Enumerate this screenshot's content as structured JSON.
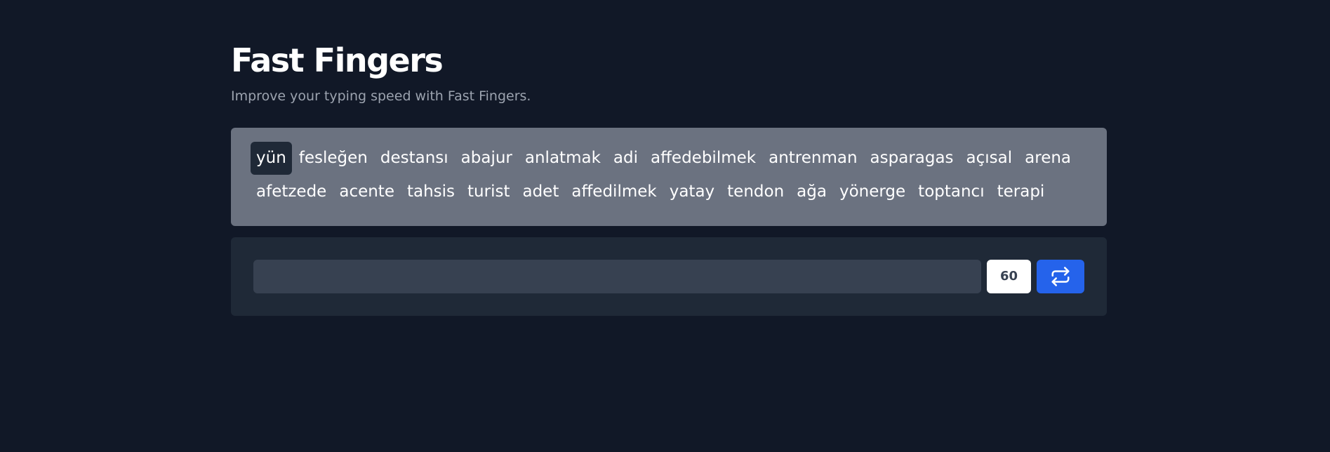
{
  "header": {
    "title": "Fast Fingers",
    "subtitle": "Improve your typing speed with Fast Fingers."
  },
  "words": [
    {
      "text": "yün",
      "current": true
    },
    {
      "text": "fesleğen",
      "current": false
    },
    {
      "text": "destansı",
      "current": false
    },
    {
      "text": "abajur",
      "current": false
    },
    {
      "text": "anlatmak",
      "current": false
    },
    {
      "text": "adi",
      "current": false
    },
    {
      "text": "affedebilmek",
      "current": false
    },
    {
      "text": "antrenman",
      "current": false
    },
    {
      "text": "asparagas",
      "current": false
    },
    {
      "text": "açısal",
      "current": false
    },
    {
      "text": "arena",
      "current": false
    },
    {
      "text": "afetzede",
      "current": false
    },
    {
      "text": "acente",
      "current": false
    },
    {
      "text": "tahsis",
      "current": false
    },
    {
      "text": "turist",
      "current": false
    },
    {
      "text": "adet",
      "current": false
    },
    {
      "text": "affedilmek",
      "current": false
    },
    {
      "text": "yatay",
      "current": false
    },
    {
      "text": "tendon",
      "current": false
    },
    {
      "text": "ağa",
      "current": false
    },
    {
      "text": "yönerge",
      "current": false
    },
    {
      "text": "toptancı",
      "current": false
    },
    {
      "text": "terapi",
      "current": false
    }
  ],
  "controls": {
    "input_value": "",
    "input_placeholder": "",
    "timer": "60",
    "restart_icon": "repeat-icon"
  },
  "colors": {
    "background": "#111827",
    "words_panel": "#6b7280",
    "current_word": "#1f2937",
    "input_panel": "#1f2937",
    "input": "#374151",
    "accent": "#2563eb",
    "subtitle": "#9ca3af"
  }
}
